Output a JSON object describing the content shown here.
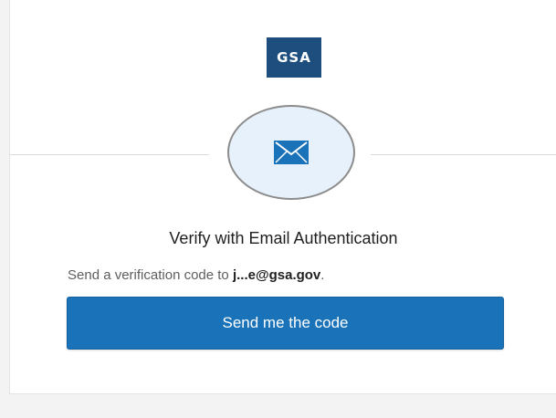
{
  "logo": {
    "text": "GSA",
    "color": "#1d4e7e"
  },
  "authenticator": {
    "icon": "email-envelope-icon",
    "circle_color": "#e6f1fb",
    "icon_color": "#1a72b9"
  },
  "header": {
    "title": "Verify with Email Authentication"
  },
  "body": {
    "prefix": "Send a verification code to ",
    "email": "j...e@gsa.gov",
    "suffix": "."
  },
  "actions": {
    "send_code_label": "Send me the code",
    "button_color": "#1a72b9"
  }
}
